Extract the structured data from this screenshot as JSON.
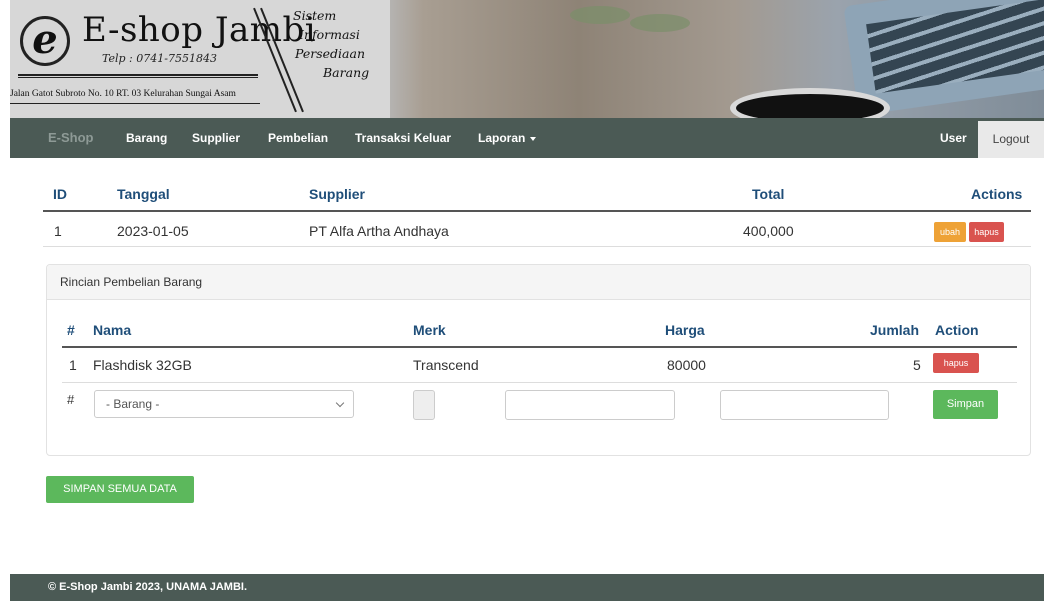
{
  "banner": {
    "logo_letter": "e",
    "shop_name": "E-shop Jambi",
    "phone": "Telp : 0741-7551843",
    "address": "Jalan Gatot Subroto No. 10 RT. 03 Kelurahan Sungai Asam",
    "tagline": [
      "Sistem",
      "Informasi",
      "Persediaan",
      "Barang"
    ]
  },
  "navbar": {
    "brand": "E-Shop",
    "items": [
      "Barang",
      "Supplier",
      "Pembelian",
      "Transaksi Keluar",
      "Laporan"
    ],
    "user": "User",
    "logout": "Logout"
  },
  "purchase_table": {
    "headers": {
      "id": "ID",
      "tanggal": "Tanggal",
      "supplier": "Supplier",
      "total": "Total",
      "actions": "Actions"
    },
    "row": {
      "id": "1",
      "tanggal": "2023-01-05",
      "supplier": "PT Alfa Artha Andhaya",
      "total": "400,000",
      "edit": "ubah",
      "delete": "hapus"
    }
  },
  "detail_panel": {
    "title": "Rincian Pembelian Barang",
    "headers": {
      "num": "#",
      "nama": "Nama",
      "merk": "Merk",
      "harga": "Harga",
      "jumlah": "Jumlah",
      "action": "Action"
    },
    "row": {
      "num": "1",
      "nama": "Flashdisk 32GB",
      "merk": "Transcend",
      "harga": "80000",
      "jumlah": "5",
      "delete": "hapus"
    },
    "new_row": {
      "num": "#",
      "barang_select": "- Barang -",
      "save": "Simpan"
    }
  },
  "save_all": "SIMPAN SEMUA DATA",
  "footer": "© E-Shop Jambi 2023, UNAMA JAMBI.",
  "colors": {
    "navbar": "#4b5a55",
    "header_text": "#1f4e79",
    "warning": "#eea236",
    "danger": "#d9534f",
    "success": "#5cb85c"
  }
}
